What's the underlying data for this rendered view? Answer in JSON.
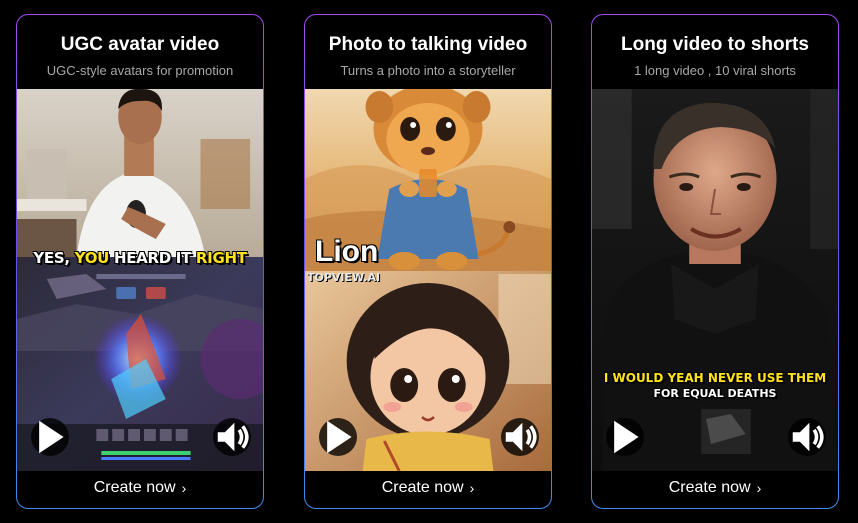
{
  "cards": [
    {
      "title": "UGC avatar video",
      "subtitle": "UGC-style avatars for promotion",
      "caption_pre": "YES, ",
      "caption_highlight": "YOU",
      "caption_mid": " HEARD IT ",
      "caption_highlight2": "RIGHT",
      "cta": "Create now"
    },
    {
      "title": "Photo to talking video",
      "subtitle": "Turns a photo into a storyteller",
      "overlay_title": "Lion",
      "watermark": "TOPVIEW.AI",
      "cta": "Create now"
    },
    {
      "title": "Long video to shorts",
      "subtitle": "1 long video , 10 viral shorts",
      "caption_line1": "I WOULD YEAH NEVER USE THEM",
      "caption_line2": "FOR EQUAL DEATHS",
      "cta": "Create now"
    }
  ],
  "icons": {
    "play": "play-icon",
    "volume": "volume-icon",
    "chevron": "chevron-right-icon"
  },
  "cta_chevron": "›",
  "colors": {
    "border_top": "#a24cf0",
    "border_bottom": "#3c8ff0",
    "caption_yellow": "#ffe21a"
  }
}
